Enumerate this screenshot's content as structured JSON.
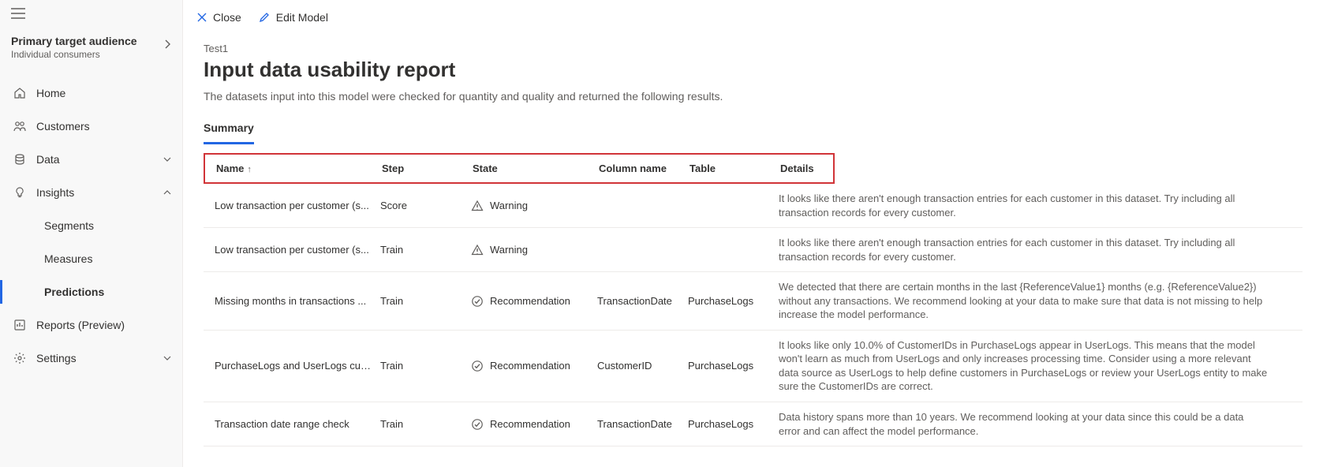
{
  "sidebar": {
    "audience_title": "Primary target audience",
    "audience_sub": "Individual consumers",
    "items": [
      {
        "label": "Home"
      },
      {
        "label": "Customers"
      },
      {
        "label": "Data"
      },
      {
        "label": "Insights"
      },
      {
        "label": "Segments"
      },
      {
        "label": "Measures"
      },
      {
        "label": "Predictions"
      },
      {
        "label": "Reports (Preview)"
      },
      {
        "label": "Settings"
      }
    ]
  },
  "toolbar": {
    "close_label": "Close",
    "edit_label": "Edit Model"
  },
  "page": {
    "breadcrumb": "Test1",
    "title": "Input data usability report",
    "description": "The datasets input into this model were checked for quantity and quality and returned the following results.",
    "tab_summary": "Summary"
  },
  "table": {
    "headers": {
      "name": "Name",
      "step": "Step",
      "state": "State",
      "column": "Column name",
      "table": "Table",
      "details": "Details"
    },
    "rows": [
      {
        "name": "Low transaction per customer (s...",
        "step": "Score",
        "state": "Warning",
        "state_kind": "warning",
        "column": "",
        "table": "",
        "details": "It looks like there aren't enough transaction entries for each customer in this dataset. Try including all transaction records for every customer."
      },
      {
        "name": "Low transaction per customer (s...",
        "step": "Train",
        "state": "Warning",
        "state_kind": "warning",
        "column": "",
        "table": "",
        "details": "It looks like there aren't enough transaction entries for each customer in this dataset. Try including all transaction records for every customer."
      },
      {
        "name": "Missing months in transactions ...",
        "step": "Train",
        "state": "Recommendation",
        "state_kind": "recommendation",
        "column": "TransactionDate",
        "table": "PurchaseLogs",
        "details": "We detected that there are certain months in the last {ReferenceValue1} months (e.g. {ReferenceValue2}) without any transactions. We recommend looking at your data to make sure that data is not missing to help increase the model performance."
      },
      {
        "name": "PurchaseLogs and UserLogs cus...",
        "step": "Train",
        "state": "Recommendation",
        "state_kind": "recommendation",
        "column": "CustomerID",
        "table": "PurchaseLogs",
        "details": "It looks like only 10.0% of CustomerIDs in PurchaseLogs appear in UserLogs. This means that the model won't learn as much from UserLogs and only increases processing time. Consider using a more relevant data source as UserLogs to help define customers in PurchaseLogs or review your UserLogs entity to make sure the CustomerIDs are correct."
      },
      {
        "name": "Transaction date range check",
        "step": "Train",
        "state": "Recommendation",
        "state_kind": "recommendation",
        "column": "TransactionDate",
        "table": "PurchaseLogs",
        "details": "Data history spans more than 10 years. We recommend looking at your data since this could be a data error and can affect the model performance."
      }
    ]
  }
}
